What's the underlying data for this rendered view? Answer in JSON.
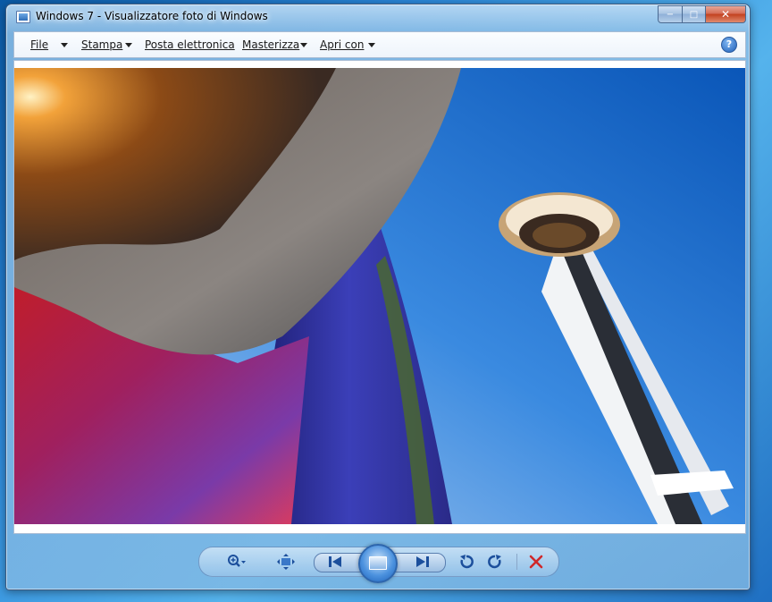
{
  "window": {
    "title": "Windows 7 - Visualizzatore foto di Windows",
    "caption_buttons": {
      "minimize": "−",
      "maximize": "□",
      "close": "✕"
    }
  },
  "menu": {
    "items": [
      {
        "label": "File",
        "has_dropdown": true
      },
      {
        "label": "Stampa",
        "has_dropdown": true
      },
      {
        "label": "Posta elettronica",
        "has_dropdown": false
      },
      {
        "label": "Masterizza",
        "has_dropdown": true
      },
      {
        "label": "Apri con",
        "has_dropdown": true
      }
    ],
    "help_label": "?"
  },
  "photo": {
    "subject": "Space Needle and curved metallic building against blue sky",
    "sky_color": "#1a6fcf",
    "building_colors": [
      "#b9651a",
      "#8a8a8a",
      "#c0285a",
      "#3a3ab0"
    ]
  },
  "controls": {
    "zoom_icon": "zoom-icon",
    "fit_icon": "fit-window-icon",
    "prev_icon": "previous-icon",
    "slideshow_icon": "slideshow-icon",
    "next_icon": "next-icon",
    "rotate_left_icon": "rotate-ccw-icon",
    "rotate_right_icon": "rotate-cw-icon",
    "delete_icon": "delete-icon",
    "delete_color": "#d0282a"
  }
}
